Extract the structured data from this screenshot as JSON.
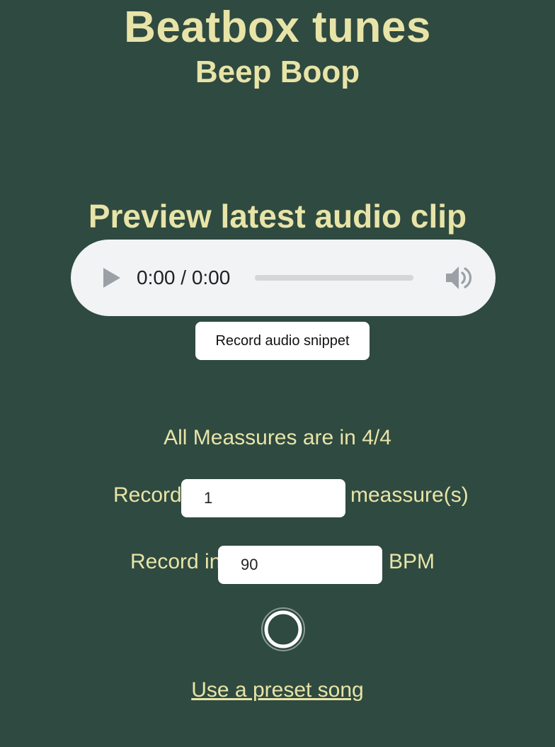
{
  "header": {
    "title": "Beatbox tunes",
    "subtitle": "Beep Boop"
  },
  "preview": {
    "heading": "Preview latest audio clip"
  },
  "player": {
    "time": "0:00 / 0:00",
    "progress": 0,
    "icons": {
      "play": "play-icon",
      "volume": "volume-icon"
    }
  },
  "controls": {
    "record_snippet_label": "Record audio snippet",
    "measure_info": "All Meassures are in 4/4",
    "record_label": "Record",
    "measures_value": "1",
    "measures_unit": "meassure(s)",
    "record_in_label": "Record in",
    "bpm_value": "90",
    "bpm_unit": "BPM",
    "record_button_icon": "record-circle-icon",
    "preset_link": "Use a preset song"
  },
  "colors": {
    "background": "#2f4a40",
    "text": "#e8e4a8",
    "player_bg": "#f1f3f4"
  }
}
